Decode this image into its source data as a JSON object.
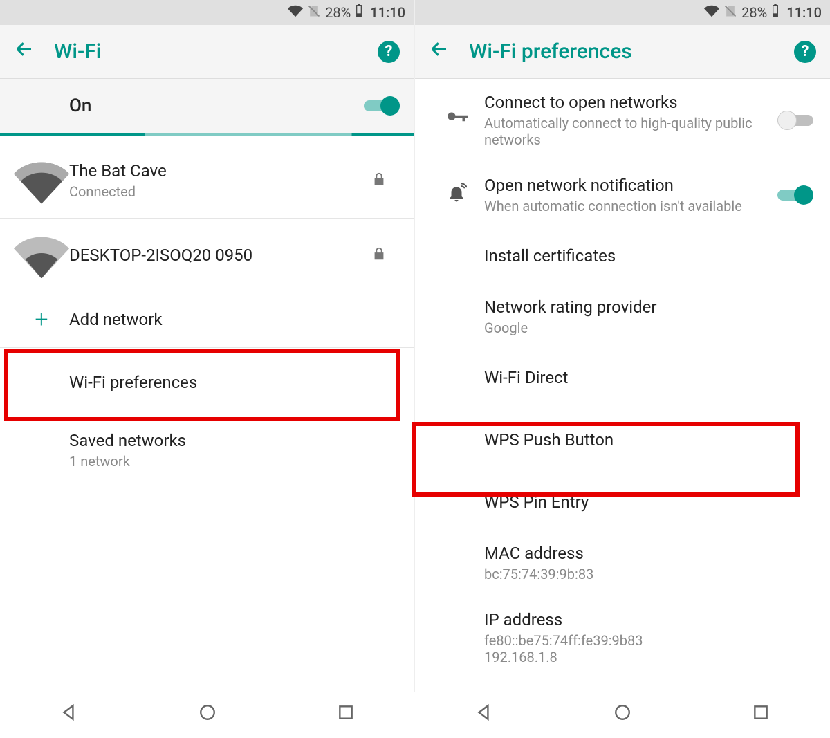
{
  "status_bar": {
    "battery_pct": "28%",
    "time": "11:10"
  },
  "left": {
    "title": "Wi-Fi",
    "toggle_label": "On",
    "networks": [
      {
        "ssid": "The Bat Cave",
        "status": "Connected",
        "locked": true,
        "strength": "full"
      },
      {
        "ssid": "DESKTOP-2ISOQ20 0950",
        "status": "",
        "locked": true,
        "strength": "medium"
      }
    ],
    "add_network": "Add network",
    "prefs_label": "Wi-Fi preferences",
    "saved_label": "Saved networks",
    "saved_sub": "1 network"
  },
  "right": {
    "title": "Wi-Fi preferences",
    "items": {
      "connect_open": {
        "title": "Connect to open networks",
        "sub": "Automatically connect to high-quality public networks"
      },
      "open_notif": {
        "title": "Open network notification",
        "sub": "When automatic connection isn't available"
      },
      "install_cert": "Install certificates",
      "rating": {
        "title": "Network rating provider",
        "sub": "Google"
      },
      "wifi_direct": "Wi-Fi Direct",
      "wps_push": "WPS Push Button",
      "wps_pin": "WPS Pin Entry",
      "mac": {
        "title": "MAC address",
        "sub": "bc:75:74:39:9b:83"
      },
      "ip": {
        "title": "IP address",
        "sub": "fe80::be75:74ff:fe39:9b83\n192.168.1.8"
      }
    }
  }
}
